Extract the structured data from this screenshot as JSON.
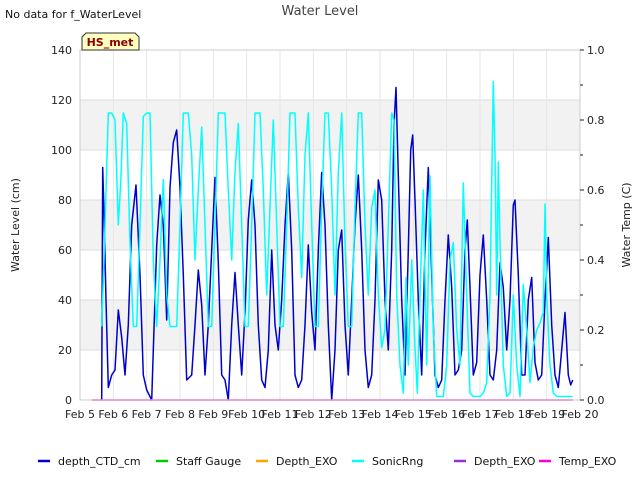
{
  "status_message": "No data for f_WaterLevel",
  "chart_data": {
    "type": "line",
    "title": "Water Level",
    "ylabel": "Water Level (cm)",
    "ylabel_right": "Water Temp (C)",
    "ylim": [
      0,
      140
    ],
    "ylim_right": [
      0,
      1.0
    ],
    "yticks": [
      0,
      20,
      40,
      60,
      80,
      100,
      120,
      140
    ],
    "yticks_right": [
      0.0,
      0.2,
      0.4,
      0.6,
      0.8,
      1.0
    ],
    "x_tick_labels": [
      "Feb 5",
      "Feb 6",
      "Feb 7",
      "Feb 8",
      "Feb 9",
      "Feb 10",
      "Feb 11",
      "Feb 12",
      "Feb 13",
      "Feb 14",
      "Feb 15",
      "Feb 16",
      "Feb 17",
      "Feb 18",
      "Feb 19",
      "Feb 20"
    ],
    "xlim": [
      5,
      20
    ],
    "grid": true,
    "annotation": "HS_met",
    "legend_position": "bottom",
    "series": [
      {
        "name": "depth_CTD_cm",
        "color": "#0000cc",
        "axis": "left",
        "points": [
          [
            5.65,
            0
          ],
          [
            5.68,
            93
          ],
          [
            5.72,
            75
          ],
          [
            5.78,
            40
          ],
          [
            5.85,
            5
          ],
          [
            5.95,
            10
          ],
          [
            6.05,
            12
          ],
          [
            6.15,
            36
          ],
          [
            6.25,
            25
          ],
          [
            6.35,
            10
          ],
          [
            6.45,
            30
          ],
          [
            6.55,
            70
          ],
          [
            6.68,
            86
          ],
          [
            6.8,
            50
          ],
          [
            6.9,
            10
          ],
          [
            7.0,
            4
          ],
          [
            7.15,
            0
          ],
          [
            7.3,
            62
          ],
          [
            7.4,
            82
          ],
          [
            7.5,
            70
          ],
          [
            7.6,
            32
          ],
          [
            7.7,
            85
          ],
          [
            7.8,
            103
          ],
          [
            7.9,
            108
          ],
          [
            8.0,
            85
          ],
          [
            8.1,
            50
          ],
          [
            8.2,
            8
          ],
          [
            8.35,
            10
          ],
          [
            8.45,
            30
          ],
          [
            8.55,
            52
          ],
          [
            8.65,
            38
          ],
          [
            8.75,
            10
          ],
          [
            8.85,
            30
          ],
          [
            8.95,
            60
          ],
          [
            9.05,
            89
          ],
          [
            9.15,
            55
          ],
          [
            9.25,
            10
          ],
          [
            9.35,
            8
          ],
          [
            9.45,
            0
          ],
          [
            9.55,
            30
          ],
          [
            9.65,
            51
          ],
          [
            9.75,
            30
          ],
          [
            9.85,
            10
          ],
          [
            9.95,
            35
          ],
          [
            10.05,
            72
          ],
          [
            10.15,
            88
          ],
          [
            10.25,
            70
          ],
          [
            10.35,
            30
          ],
          [
            10.45,
            8
          ],
          [
            10.55,
            5
          ],
          [
            10.65,
            20
          ],
          [
            10.75,
            60
          ],
          [
            10.85,
            30
          ],
          [
            10.95,
            20
          ],
          [
            11.05,
            40
          ],
          [
            11.15,
            70
          ],
          [
            11.25,
            91
          ],
          [
            11.35,
            60
          ],
          [
            11.45,
            10
          ],
          [
            11.55,
            5
          ],
          [
            11.65,
            8
          ],
          [
            11.75,
            30
          ],
          [
            11.85,
            62
          ],
          [
            11.95,
            35
          ],
          [
            12.05,
            20
          ],
          [
            12.15,
            60
          ],
          [
            12.25,
            91
          ],
          [
            12.35,
            70
          ],
          [
            12.45,
            30
          ],
          [
            12.55,
            0
          ],
          [
            12.65,
            20
          ],
          [
            12.75,
            60
          ],
          [
            12.85,
            68
          ],
          [
            12.95,
            30
          ],
          [
            13.05,
            10
          ],
          [
            13.15,
            40
          ],
          [
            13.25,
            70
          ],
          [
            13.35,
            90
          ],
          [
            13.45,
            60
          ],
          [
            13.55,
            20
          ],
          [
            13.65,
            5
          ],
          [
            13.75,
            10
          ],
          [
            13.85,
            40
          ],
          [
            13.95,
            88
          ],
          [
            14.05,
            80
          ],
          [
            14.15,
            40
          ],
          [
            14.25,
            20
          ],
          [
            14.35,
            60
          ],
          [
            14.42,
            110
          ],
          [
            14.48,
            125
          ],
          [
            14.55,
            90
          ],
          [
            14.65,
            40
          ],
          [
            14.75,
            10
          ],
          [
            14.85,
            60
          ],
          [
            14.92,
            100
          ],
          [
            14.98,
            106
          ],
          [
            15.05,
            80
          ],
          [
            15.15,
            40
          ],
          [
            15.25,
            10
          ],
          [
            15.35,
            60
          ],
          [
            15.45,
            93
          ],
          [
            15.55,
            50
          ],
          [
            15.65,
            10
          ],
          [
            15.75,
            5
          ],
          [
            15.85,
            8
          ],
          [
            15.95,
            40
          ],
          [
            16.05,
            66
          ],
          [
            16.15,
            45
          ],
          [
            16.25,
            10
          ],
          [
            16.35,
            12
          ],
          [
            16.45,
            20
          ],
          [
            16.55,
            60
          ],
          [
            16.62,
            72
          ],
          [
            16.7,
            45
          ],
          [
            16.8,
            10
          ],
          [
            16.9,
            15
          ],
          [
            17.0,
            50
          ],
          [
            17.1,
            66
          ],
          [
            17.2,
            40
          ],
          [
            17.3,
            10
          ],
          [
            17.4,
            8
          ],
          [
            17.5,
            20
          ],
          [
            17.6,
            55
          ],
          [
            17.7,
            45
          ],
          [
            17.8,
            20
          ],
          [
            17.9,
            40
          ],
          [
            18.0,
            78
          ],
          [
            18.05,
            80
          ],
          [
            18.15,
            50
          ],
          [
            18.25,
            10
          ],
          [
            18.35,
            10
          ],
          [
            18.45,
            40
          ],
          [
            18.55,
            49
          ],
          [
            18.65,
            15
          ],
          [
            18.75,
            8
          ],
          [
            18.85,
            10
          ],
          [
            18.95,
            40
          ],
          [
            19.05,
            65
          ],
          [
            19.15,
            30
          ],
          [
            19.25,
            10
          ],
          [
            19.35,
            5
          ],
          [
            19.45,
            20
          ],
          [
            19.55,
            35
          ],
          [
            19.65,
            10
          ],
          [
            19.72,
            6
          ],
          [
            19.78,
            8
          ]
        ]
      },
      {
        "name": "Staff Gauge",
        "color": "#00cc00",
        "axis": "left",
        "points": []
      },
      {
        "name": "Depth_EXO",
        "color": "#ffa500",
        "axis": "left",
        "points": []
      },
      {
        "name": "SonicRng",
        "color": "#00ffff",
        "axis": "right",
        "points": [
          [
            5.65,
            0.21
          ],
          [
            5.72,
            0.4
          ],
          [
            5.85,
            0.82
          ],
          [
            5.95,
            0.82
          ],
          [
            6.05,
            0.8
          ],
          [
            6.15,
            0.5
          ],
          [
            6.22,
            0.62
          ],
          [
            6.3,
            0.82
          ],
          [
            6.4,
            0.79
          ],
          [
            6.5,
            0.45
          ],
          [
            6.6,
            0.21
          ],
          [
            6.7,
            0.21
          ],
          [
            6.8,
            0.5
          ],
          [
            6.9,
            0.81
          ],
          [
            7.0,
            0.82
          ],
          [
            7.1,
            0.82
          ],
          [
            7.2,
            0.4
          ],
          [
            7.3,
            0.21
          ],
          [
            7.4,
            0.4
          ],
          [
            7.5,
            0.63
          ],
          [
            7.6,
            0.3
          ],
          [
            7.7,
            0.21
          ],
          [
            7.8,
            0.21
          ],
          [
            7.9,
            0.21
          ],
          [
            8.0,
            0.5
          ],
          [
            8.1,
            0.82
          ],
          [
            8.25,
            0.82
          ],
          [
            8.35,
            0.7
          ],
          [
            8.45,
            0.4
          ],
          [
            8.55,
            0.6
          ],
          [
            8.65,
            0.78
          ],
          [
            8.75,
            0.5
          ],
          [
            8.85,
            0.21
          ],
          [
            8.95,
            0.21
          ],
          [
            9.05,
            0.5
          ],
          [
            9.15,
            0.82
          ],
          [
            9.35,
            0.82
          ],
          [
            9.45,
            0.6
          ],
          [
            9.55,
            0.4
          ],
          [
            9.65,
            0.65
          ],
          [
            9.75,
            0.79
          ],
          [
            9.85,
            0.5
          ],
          [
            9.95,
            0.21
          ],
          [
            10.05,
            0.21
          ],
          [
            10.15,
            0.5
          ],
          [
            10.25,
            0.82
          ],
          [
            10.4,
            0.82
          ],
          [
            10.5,
            0.6
          ],
          [
            10.6,
            0.3
          ],
          [
            10.7,
            0.55
          ],
          [
            10.8,
            0.8
          ],
          [
            10.9,
            0.5
          ],
          [
            11.0,
            0.21
          ],
          [
            11.1,
            0.21
          ],
          [
            11.2,
            0.5
          ],
          [
            11.3,
            0.82
          ],
          [
            11.45,
            0.82
          ],
          [
            11.55,
            0.55
          ],
          [
            11.65,
            0.35
          ],
          [
            11.75,
            0.7
          ],
          [
            11.85,
            0.82
          ],
          [
            11.95,
            0.5
          ],
          [
            12.05,
            0.21
          ],
          [
            12.15,
            0.21
          ],
          [
            12.25,
            0.55
          ],
          [
            12.35,
            0.82
          ],
          [
            12.45,
            0.82
          ],
          [
            12.55,
            0.6
          ],
          [
            12.65,
            0.3
          ],
          [
            12.75,
            0.65
          ],
          [
            12.85,
            0.82
          ],
          [
            12.95,
            0.45
          ],
          [
            13.05,
            0.21
          ],
          [
            13.15,
            0.21
          ],
          [
            13.25,
            0.55
          ],
          [
            13.35,
            0.82
          ],
          [
            13.45,
            0.82
          ],
          [
            13.55,
            0.5
          ],
          [
            13.65,
            0.3
          ],
          [
            13.75,
            0.55
          ],
          [
            13.85,
            0.6
          ],
          [
            13.95,
            0.3
          ],
          [
            14.05,
            0.15
          ],
          [
            14.15,
            0.2
          ],
          [
            14.25,
            0.5
          ],
          [
            14.35,
            0.82
          ],
          [
            14.42,
            0.8
          ],
          [
            14.5,
            0.3
          ],
          [
            14.6,
            0.1
          ],
          [
            14.7,
            0.02
          ],
          [
            14.78,
            0.35
          ],
          [
            14.85,
            0.1
          ],
          [
            14.95,
            0.4
          ],
          [
            15.05,
            0.15
          ],
          [
            15.12,
            0.02
          ],
          [
            15.2,
            0.3
          ],
          [
            15.3,
            0.6
          ],
          [
            15.4,
            0.1
          ],
          [
            15.5,
            0.64
          ],
          [
            15.6,
            0.2
          ],
          [
            15.7,
            0.01
          ],
          [
            15.8,
            0.01
          ],
          [
            15.9,
            0.01
          ],
          [
            16.0,
            0.1
          ],
          [
            16.1,
            0.4
          ],
          [
            16.2,
            0.45
          ],
          [
            16.3,
            0.2
          ],
          [
            16.4,
            0.1
          ],
          [
            16.5,
            0.62
          ],
          [
            16.6,
            0.3
          ],
          [
            16.7,
            0.02
          ],
          [
            16.8,
            0.01
          ],
          [
            16.9,
            0.01
          ],
          [
            17.0,
            0.01
          ],
          [
            17.1,
            0.02
          ],
          [
            17.2,
            0.05
          ],
          [
            17.3,
            0.3
          ],
          [
            17.4,
            0.91
          ],
          [
            17.45,
            0.7
          ],
          [
            17.5,
            0.3
          ],
          [
            17.55,
            0.68
          ],
          [
            17.6,
            0.45
          ],
          [
            17.7,
            0.1
          ],
          [
            17.8,
            0.01
          ],
          [
            17.9,
            0.02
          ],
          [
            18.0,
            0.3
          ],
          [
            18.1,
            0.1
          ],
          [
            18.2,
            0.01
          ],
          [
            18.3,
            0.33
          ],
          [
            18.4,
            0.2
          ],
          [
            18.5,
            0.05
          ],
          [
            18.6,
            0.15
          ],
          [
            18.7,
            0.2
          ],
          [
            18.8,
            0.22
          ],
          [
            18.9,
            0.25
          ],
          [
            18.95,
            0.56
          ],
          [
            19.0,
            0.3
          ],
          [
            19.1,
            0.1
          ],
          [
            19.2,
            0.02
          ],
          [
            19.3,
            0.01
          ],
          [
            19.4,
            0.01
          ],
          [
            19.5,
            0.01
          ],
          [
            19.6,
            0.01
          ],
          [
            19.78,
            0.01
          ]
        ]
      },
      {
        "name": "Depth_EXO",
        "color": "#9932cc",
        "axis": "left",
        "points": []
      },
      {
        "name": "Temp_EXO",
        "color": "#ff00cc",
        "axis": "right",
        "points": [
          [
            5.35,
            0.0
          ],
          [
            19.78,
            0.0
          ]
        ]
      }
    ]
  }
}
